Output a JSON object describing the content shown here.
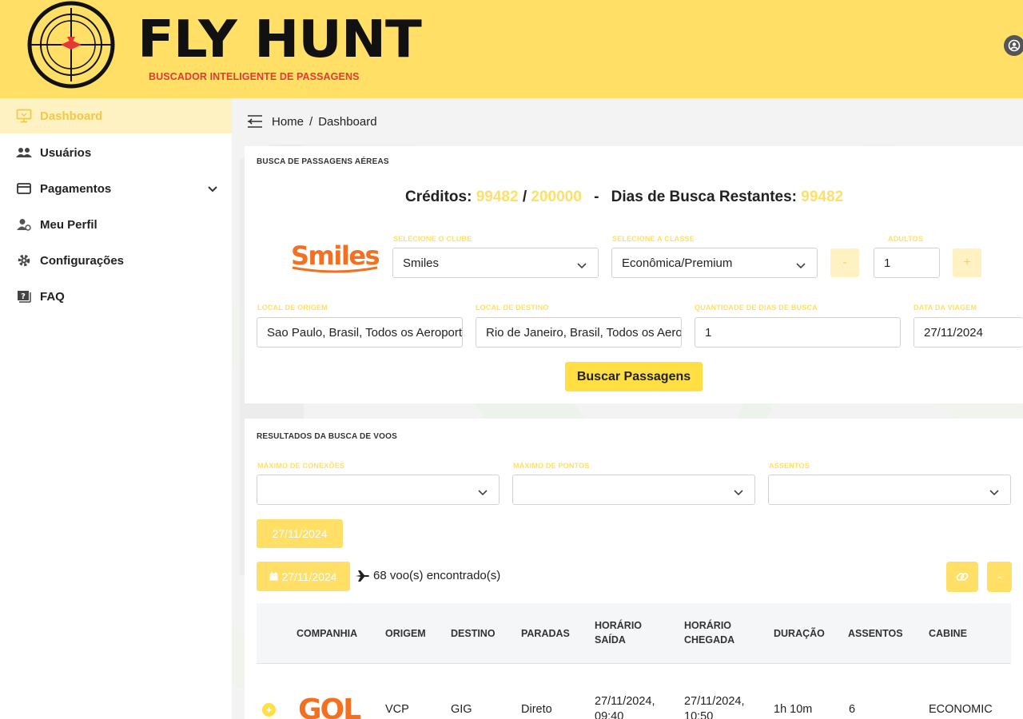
{
  "header": {
    "brand_title": "FLY HUNT",
    "brand_subtitle": "BUSCADOR INTELIGENTE DE PASSAGENS"
  },
  "sidebar": {
    "items": [
      {
        "label": "Dashboard",
        "icon": "monitor-icon",
        "active": true
      },
      {
        "label": "Usuários",
        "icon": "users-icon"
      },
      {
        "label": "Pagamentos",
        "icon": "credit-card-icon",
        "has_submenu": true
      },
      {
        "label": "Meu Perfil",
        "icon": "user-settings-icon"
      },
      {
        "label": "Configurações",
        "icon": "gear-icon"
      },
      {
        "label": "FAQ",
        "icon": "question-box-icon"
      }
    ]
  },
  "breadcrumb": {
    "home": "Home",
    "separator": "/",
    "current": "Dashboard"
  },
  "search": {
    "title": "BUSCA DE PASSAGENS AÉREAS",
    "credits_label": "Créditos:",
    "credits_used": "99482",
    "credits_sep": "/",
    "credits_total": "200000",
    "dash": "-",
    "days_label": "Dias de Busca Restantes:",
    "days_value": "99482",
    "club_logo_text": "Smiles",
    "club_label": "SELECIONE O CLUBE",
    "club_value": "Smiles",
    "class_label": "SELECIONE A CLASSE",
    "class_value": "Econômica/Premium",
    "adults_label": "ADULTOS",
    "adults_minus": "-",
    "adults_value": "1",
    "adults_plus": "+",
    "origin_label": "LOCAL DE ORIGEM",
    "origin_value": "Sao Paulo, Brasil, Todos os Aeroportos",
    "dest_label": "LOCAL DE DESTINO",
    "dest_value": "Rio de Janeiro, Brasil, Todos os Aeroportos",
    "days_qty_label": "QUANTIDADE DE DIAS DE BUSCA",
    "days_qty_value": "1",
    "date_label": "DATA DA VIAGEM",
    "date_value": "27/11/2024",
    "submit_label": "Buscar Passagens"
  },
  "results": {
    "title": "RESULTADOS DA BUSCA DE VOOS",
    "filter_connections_label": "MÁXIMO DE CONEXÕES",
    "filter_points_label": "MÁXIMO DE PONTOS",
    "filter_seats_label": "ASSENTOS",
    "date_tab": "27/11/2024",
    "date_chip": "27/11/2024",
    "found_text": "68 voo(s) encontrado(s)",
    "link_button_icon": "link-icon",
    "collapse_label": "-",
    "columns": [
      {
        "line1": "COMPANHIA"
      },
      {
        "line1": "ORIGEM"
      },
      {
        "line1": "DESTINO"
      },
      {
        "line1": "PARADAS"
      },
      {
        "line1": "HORÁRIO",
        "line2": "SAÍDA"
      },
      {
        "line1": "HORÁRIO",
        "line2": "CHEGADA"
      },
      {
        "line1": "DURAÇÃO"
      },
      {
        "line1": "ASSENTOS"
      },
      {
        "line1": "CABINE"
      }
    ],
    "rows": [
      {
        "airline_logo_text": "GOL",
        "origin": "VCP",
        "destination": "GIG",
        "stops": "Direto",
        "departure_l1": "27/11/2024,",
        "departure_l2": "09:40",
        "arrival_l1": "27/11/2024,",
        "arrival_l2": "10:50",
        "duration": "1h 10m",
        "seats": "6",
        "cabin": "ECONOMIC"
      }
    ]
  },
  "colors": {
    "brand_yellow": "#ffdf66",
    "brand_red": "#e53935",
    "smiles_orange": "#f37021"
  }
}
